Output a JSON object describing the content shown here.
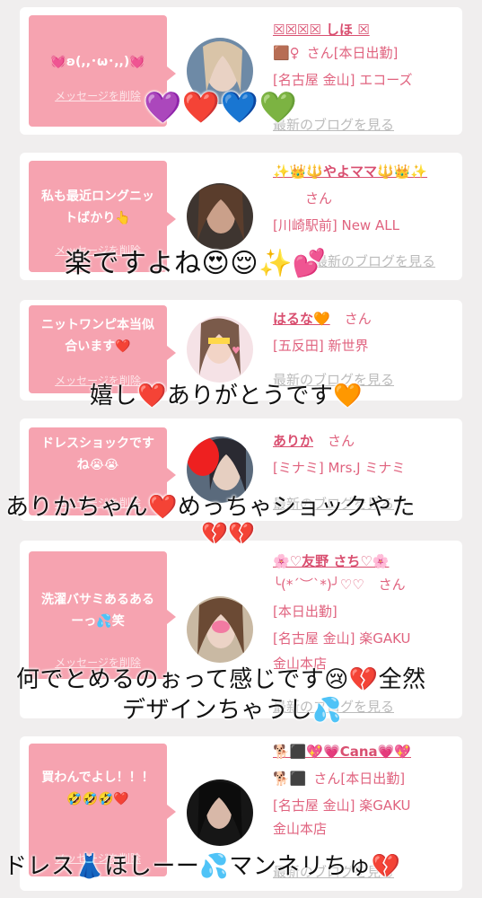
{
  "delete_label": "メッセージを削除",
  "blog_label": "最新のブログを見る",
  "san": "さん",
  "cards": [
    {
      "message": "💓ʚ(,,･ω･,,)💓",
      "name": "☒☒☒☒ しほ ☒",
      "tag": "🟫♀",
      "status": "[本日出勤]",
      "shop": "[名古屋 金山] エコーズ"
    },
    {
      "message": "私も最近ロングニットばかり👆",
      "name": "✨👑🔱やよママ🔱👑✨",
      "shop": "[川崎駅前] New ALL"
    },
    {
      "message": "ニットワンピ本当似合います❤️",
      "name": "はるな🧡",
      "shop": "[五反田] 新世界"
    },
    {
      "message": "ドレスショックですね😭😭",
      "name": "ありか",
      "shop": "[ミナミ] Mrs.J ミナミ"
    },
    {
      "message": "洗濯バサミあるあるーっ💦笑",
      "name": "🌸♡友野 さち♡🌸",
      "tag": "╰(*´︶`*)╯♡♡",
      "status": "[本日出勤]",
      "shop": "[名古屋 金山] 楽GAKU",
      "shop2": "金山本店"
    },
    {
      "message": "買わんでよし！！！🤣🤣🤣❤️",
      "name": "🐕⬛💖💗Cana💗💖",
      "tag": "🐕⬛",
      "status": "[本日出勤]",
      "shop": "[名古屋 金山] 楽GAKU",
      "shop2": "金山本店"
    }
  ],
  "overlays": {
    "hearts": "💜❤️💙💚",
    "o1": "楽ですよね😍😌✨💕",
    "o2": "嬉し❤️ありがとうです🧡",
    "o3a": "ありかちゃん❤️めっちゃショックやた",
    "o3b": "💔💔",
    "o4a": "何でとめるのぉって感じです😢💔全然",
    "o4b": "デザインちゃうし💦",
    "o5": "ドレス👗ほしーー💦マンネリちゅ💔"
  }
}
